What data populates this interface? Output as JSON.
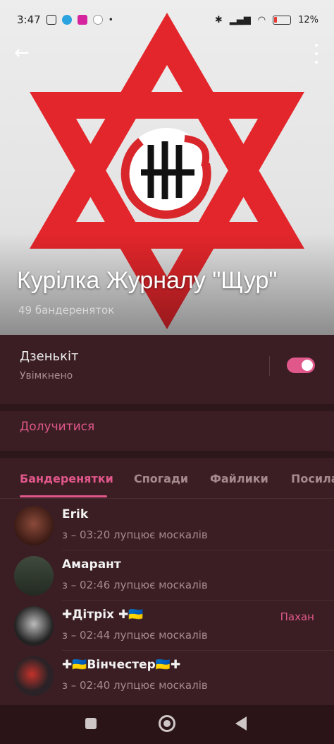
{
  "status_bar": {
    "time": "3:47",
    "battery": "12%",
    "icons": [
      "nfc-icon",
      "telegram-icon",
      "instagram-icon",
      "google-icon",
      "dot-icon",
      "bluetooth-icon",
      "signal-icon",
      "wifi-icon",
      "battery-icon"
    ]
  },
  "header": {
    "title": "Курілка Журналу \"Щур\"",
    "members": "49 бандереняток",
    "back_icon": "arrow-left-icon",
    "menu_icon": "more-vertical-icon"
  },
  "notifications": {
    "label": "Дзенькіт",
    "state": "Увімкнено",
    "enabled": true
  },
  "join": {
    "label": "Долучитися"
  },
  "tabs": [
    "Бандеренятки",
    "Спогади",
    "Файлики",
    "Посилання"
  ],
  "active_tab": 0,
  "members": [
    {
      "name": "Erik",
      "status": "з – 03:20 лупцює москалів",
      "role": ""
    },
    {
      "name": "Амарант",
      "status": "з – 02:46 лупцює москалів",
      "role": ""
    },
    {
      "name": "✚Дітріх ✚🇺🇦",
      "status": "з – 02:44 лупцює москалів",
      "role": "Пахан"
    },
    {
      "name": "✚🇺🇦Вінчестер🇺🇦✚",
      "status": "з – 02:40 лупцює москалів",
      "role": ""
    }
  ],
  "colors": {
    "accent": "#e0578a",
    "background": "#2e171b",
    "card": "#3a1e23",
    "star_red": "#e3262b"
  }
}
